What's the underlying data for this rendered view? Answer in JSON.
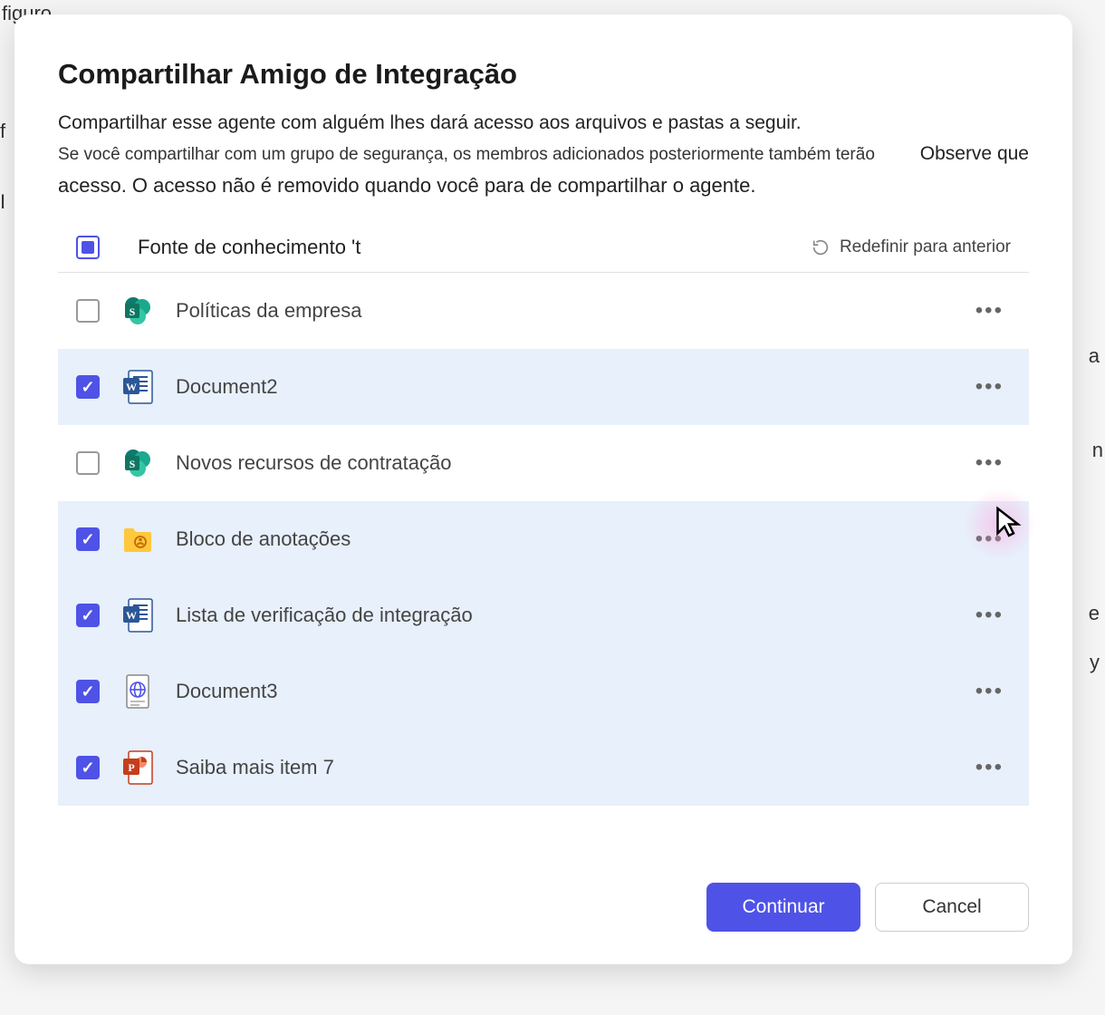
{
  "dialog": {
    "title": "Compartilhar Amigo de Integração",
    "description_line1": "Compartilhar esse agente com alguém lhes dará acesso aos arquivos e pastas a seguir.",
    "description_line2": "Se você compartilhar com um grupo de segurança, os membros adicionados posteriormente também terão",
    "description_note": "Observe que",
    "description_line3": "acesso. O acesso não é removido quando você para de compartilhar o agente."
  },
  "header": {
    "checkbox_state": "indeterminate",
    "label": "Fonte de conhecimento 't",
    "reset_label": "Redefinir para anterior"
  },
  "items": [
    {
      "checked": false,
      "icon": "sharepoint",
      "label": "Políticas da empresa"
    },
    {
      "checked": true,
      "icon": "word",
      "label": "Document2"
    },
    {
      "checked": false,
      "icon": "sharepoint",
      "label": "Novos recursos de contratação"
    },
    {
      "checked": true,
      "icon": "folder",
      "label": "Bloco de anotações"
    },
    {
      "checked": true,
      "icon": "word",
      "label": "Lista de verificação de integração"
    },
    {
      "checked": true,
      "icon": "globe",
      "label": "Document3"
    },
    {
      "checked": true,
      "icon": "powerpoint",
      "label": "Saiba mais item 7"
    }
  ],
  "footer": {
    "continue_label": "Continuar",
    "cancel_label": "Cancel"
  }
}
